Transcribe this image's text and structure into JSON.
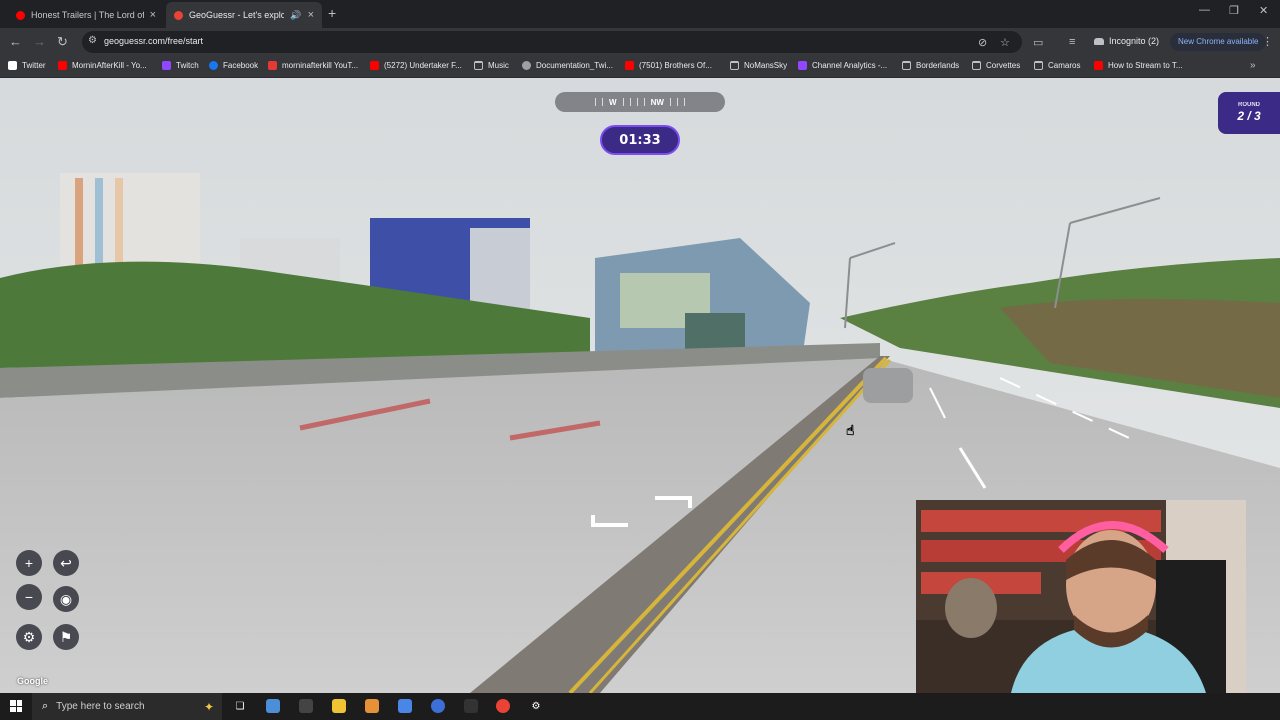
{
  "tabs": [
    {
      "title": "Honest Trailers | The Lord of the",
      "favicon_color": "#ff0000",
      "close": "×"
    },
    {
      "title": "GeoGuessr - Let's explore th",
      "favicon_color": "#ea4335",
      "close": "×",
      "audio": "🔊"
    }
  ],
  "new_tab": "+",
  "window_controls": {
    "minimize": "—",
    "maximize": "❐",
    "close": "✕"
  },
  "toolbar": {
    "back": "←",
    "forward": "→",
    "reload": "↻",
    "url": "geoguessr.com/free/start",
    "incognito_label": "Incognito (2)",
    "update_label": "New Chrome available",
    "menu": "⋮"
  },
  "bookmarks": [
    {
      "label": "Twitter",
      "icon": "x-icon",
      "color": "#ffffff"
    },
    {
      "label": "MorninAfterKill - Yo...",
      "icon": "youtube-icon",
      "color": "#ff0000"
    },
    {
      "label": "Twitch",
      "icon": "twitch-icon",
      "color": "#9146ff"
    },
    {
      "label": "Facebook",
      "icon": "facebook-icon",
      "color": "#1877f2"
    },
    {
      "label": "morninafterkill YouT...",
      "icon": "bar-icon",
      "color": "#e53935"
    },
    {
      "label": "(5272) Undertaker F...",
      "icon": "youtube-icon",
      "color": "#ff0000"
    },
    {
      "label": "Music",
      "icon": "folder-icon",
      "color": ""
    },
    {
      "label": "Documentation_Twi...",
      "icon": "globe-icon",
      "color": "#9aa0a6"
    },
    {
      "label": "(7501) Brothers Of...",
      "icon": "youtube-icon",
      "color": "#ff0000"
    },
    {
      "label": "NoMansSky",
      "icon": "folder-icon",
      "color": ""
    },
    {
      "label": "Channel Analytics -...",
      "icon": "twitch-icon",
      "color": "#9146ff"
    },
    {
      "label": "Borderlands",
      "icon": "folder-icon",
      "color": ""
    },
    {
      "label": "Corvettes",
      "icon": "folder-icon",
      "color": ""
    },
    {
      "label": "Camaros",
      "icon": "folder-icon",
      "color": ""
    },
    {
      "label": "How to Stream to T...",
      "icon": "youtube-icon",
      "color": "#ff0000"
    }
  ],
  "bookmarks_more": "»",
  "game": {
    "compass_w": "W",
    "compass_nw": "NW",
    "timer": "01:33",
    "round_label": "ROUND",
    "round_value": "2 / 3",
    "zoom_in": "+",
    "zoom_out": "−",
    "undo": "↩",
    "pin": "◉",
    "settings": "⚙",
    "flag": "⚑",
    "map_credit": "Google",
    "accent_color": "#3b2a86"
  },
  "taskbar": {
    "search_placeholder": "Type here to search"
  }
}
